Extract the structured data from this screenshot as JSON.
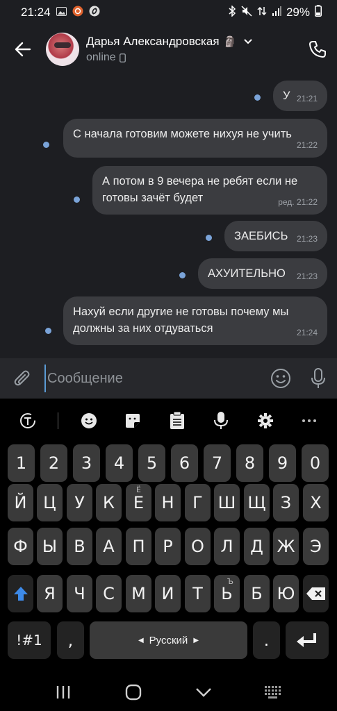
{
  "status_bar": {
    "time": "21:24",
    "battery": "29%"
  },
  "header": {
    "back_icon": "arrow-left-icon",
    "contact_name": "Дарья Александровская",
    "name_emoji": "🗿",
    "status": "online",
    "status_icon": "phone-device-icon",
    "call_icon": "phone-icon"
  },
  "messages": [
    {
      "text": "У",
      "time": "21:21"
    },
    {
      "text": "С начала готовим можете нихуя не учить",
      "time": "21:22"
    },
    {
      "text": "А потом в 9 вечера не ребят если не готовы зачёт будет",
      "time": "ред. 21:22"
    },
    {
      "text": "ЗАЕБИСЬ",
      "time": "21:23"
    },
    {
      "text": "АХУИТЕЛЬНО",
      "time": "21:23"
    },
    {
      "text": "Нахуй если другие не готовы почему мы должны за них отдуваться",
      "time": "21:24"
    }
  ],
  "input": {
    "placeholder": "Сообщение",
    "value": ""
  },
  "keyboard": {
    "toolbar_icons": [
      "translate-icon",
      "emoji-icon",
      "sticker-icon",
      "clipboard-icon",
      "microphone-icon",
      "settings-gear-icon",
      "more-icon"
    ],
    "row_numbers": [
      "1",
      "2",
      "3",
      "4",
      "5",
      "6",
      "7",
      "8",
      "9",
      "0"
    ],
    "row1": [
      "Й",
      "Ц",
      "У",
      "К",
      "Е",
      "Н",
      "Г",
      "Ш",
      "Щ",
      "З",
      "Х"
    ],
    "row1_hint_e": "Ё",
    "row2": [
      "Ф",
      "Ы",
      "В",
      "А",
      "П",
      "Р",
      "О",
      "Л",
      "Д",
      "Ж",
      "Э"
    ],
    "row3": [
      "Я",
      "Ч",
      "С",
      "М",
      "И",
      "Т",
      "Ь",
      "Б",
      "Ю"
    ],
    "row3_hint_soft": "Ъ",
    "symbols_key": "!#1",
    "comma_key": ",",
    "space_label": "Русский",
    "period_key": "."
  },
  "nav": {
    "recents_icon": "recents-icon",
    "home_icon": "home-icon",
    "back_icon": "nav-back-icon",
    "keyboard_icon": "keyboard-grid-icon"
  }
}
